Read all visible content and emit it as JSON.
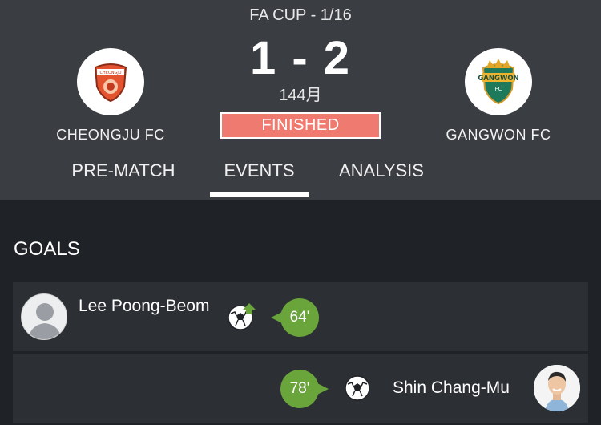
{
  "header": {
    "competition": "FA CUP - 1/16",
    "score": "1 - 2",
    "minute": "144月",
    "status": "FINISHED",
    "home_team": {
      "name": "CHEONGJU FC",
      "logo_icon": "cheongju-fc-crest-icon"
    },
    "away_team": {
      "name": "GANGWON FC",
      "logo_icon": "gangwon-fc-crest-icon"
    }
  },
  "tabs": [
    {
      "label": "PRE-MATCH",
      "active": false
    },
    {
      "label": "EVENTS",
      "active": true
    },
    {
      "label": "ANALYSIS",
      "active": false
    }
  ],
  "goals": {
    "title": "GOALS",
    "events": [
      {
        "side": "home",
        "player": "Lee Poong-Beom",
        "minute": "64'",
        "icon": "soccer-ball-with-assist-icon"
      },
      {
        "side": "away",
        "player": "Shin Chang-Mu",
        "minute": "78'",
        "icon": "soccer-ball-icon"
      }
    ]
  },
  "colors": {
    "header_bg": "#3a3d42",
    "page_bg": "#1f2226",
    "row_bg": "#2c2f34",
    "status_bg": "#ef7a6f",
    "minute_badge": "#6aa53b"
  }
}
